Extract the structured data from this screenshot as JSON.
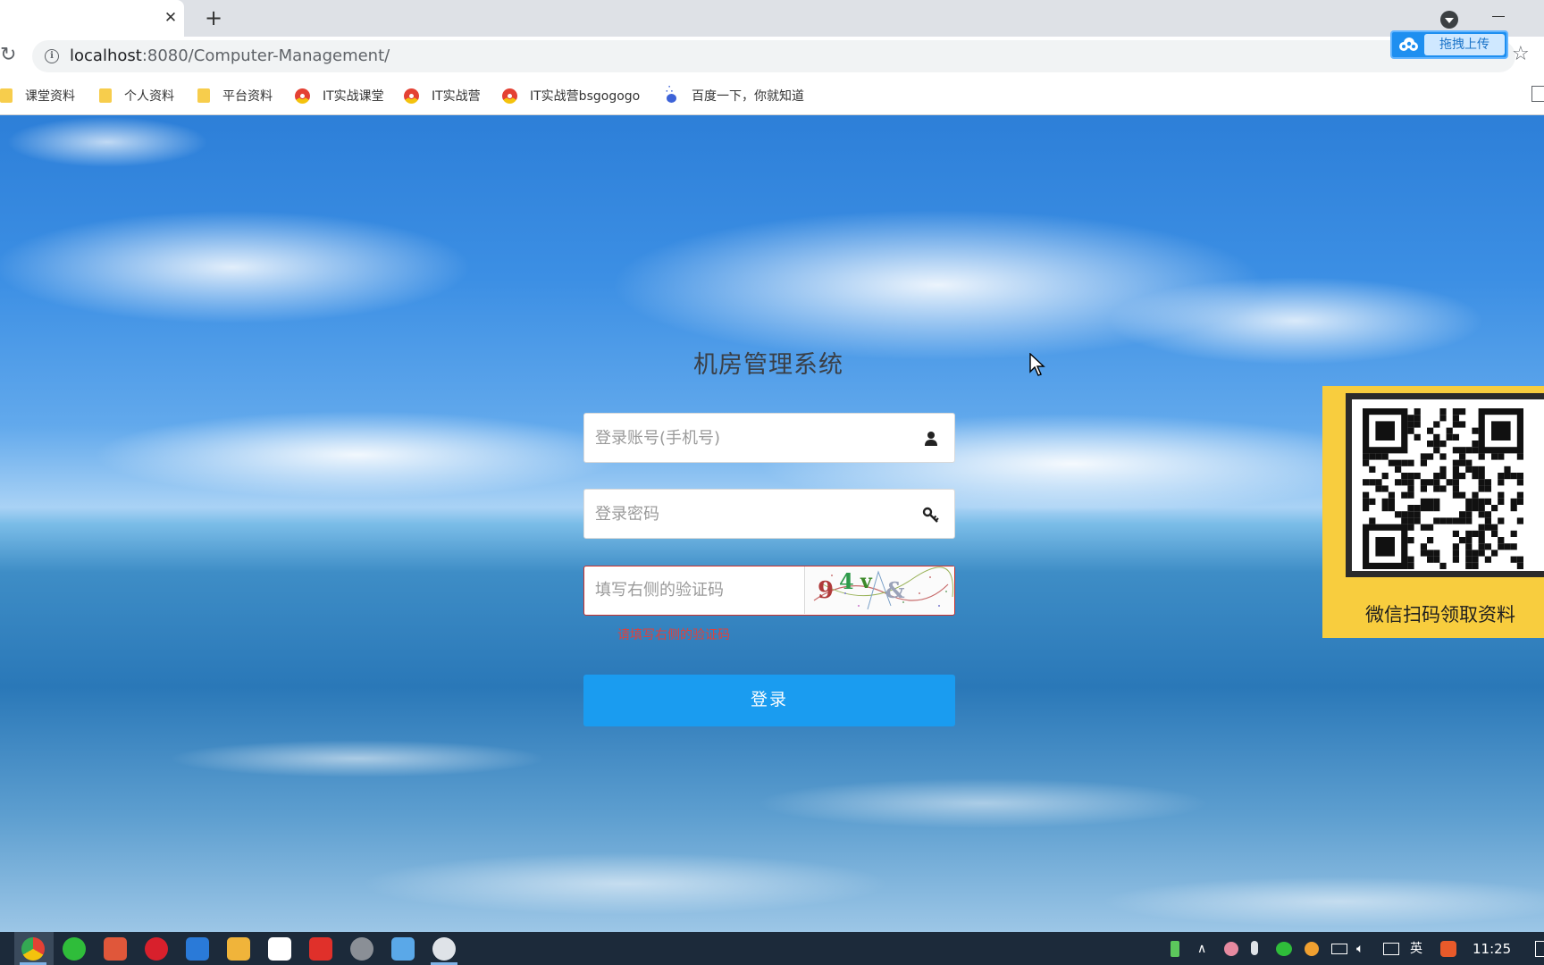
{
  "browser": {
    "tab_close_glyph": "✕",
    "new_tab_glyph": "+",
    "reload_glyph": "↻",
    "info_glyph": "i",
    "url_host": "localhost",
    "url_path": ":8080/Computer-Management/",
    "star_glyph": "☆",
    "upload_label": "拖拽上传"
  },
  "bookmarks": [
    {
      "label": "课堂资料",
      "icon": "folder-icon"
    },
    {
      "label": "个人资料",
      "icon": "folder-icon"
    },
    {
      "label": "平台资料",
      "icon": "folder-icon"
    },
    {
      "label": "IT实战课堂",
      "icon": "chrome-icon"
    },
    {
      "label": "IT实战营",
      "icon": "chrome-icon"
    },
    {
      "label": "IT实战营bsgogogo",
      "icon": "chrome-icon"
    },
    {
      "label": "百度一下，你就知道",
      "icon": "baidu-icon"
    }
  ],
  "login": {
    "title": "机房管理系统",
    "account_placeholder": "登录账号(手机号)",
    "password_placeholder": "登录密码",
    "captcha_placeholder": "填写右侧的验证码",
    "captcha_chars": [
      "9",
      "4",
      "v",
      "&"
    ],
    "captcha_error": "请填写右侧的验证码",
    "submit_label": "登录"
  },
  "qr_panel": {
    "caption": "微信扫码领取资料"
  },
  "taskbar": {
    "ime_label": "英",
    "clock": "11:25"
  },
  "colors": {
    "primary_button": "#1a9cf0",
    "error_red": "#e0413b",
    "qr_panel_yellow": "#f8cd3e"
  }
}
